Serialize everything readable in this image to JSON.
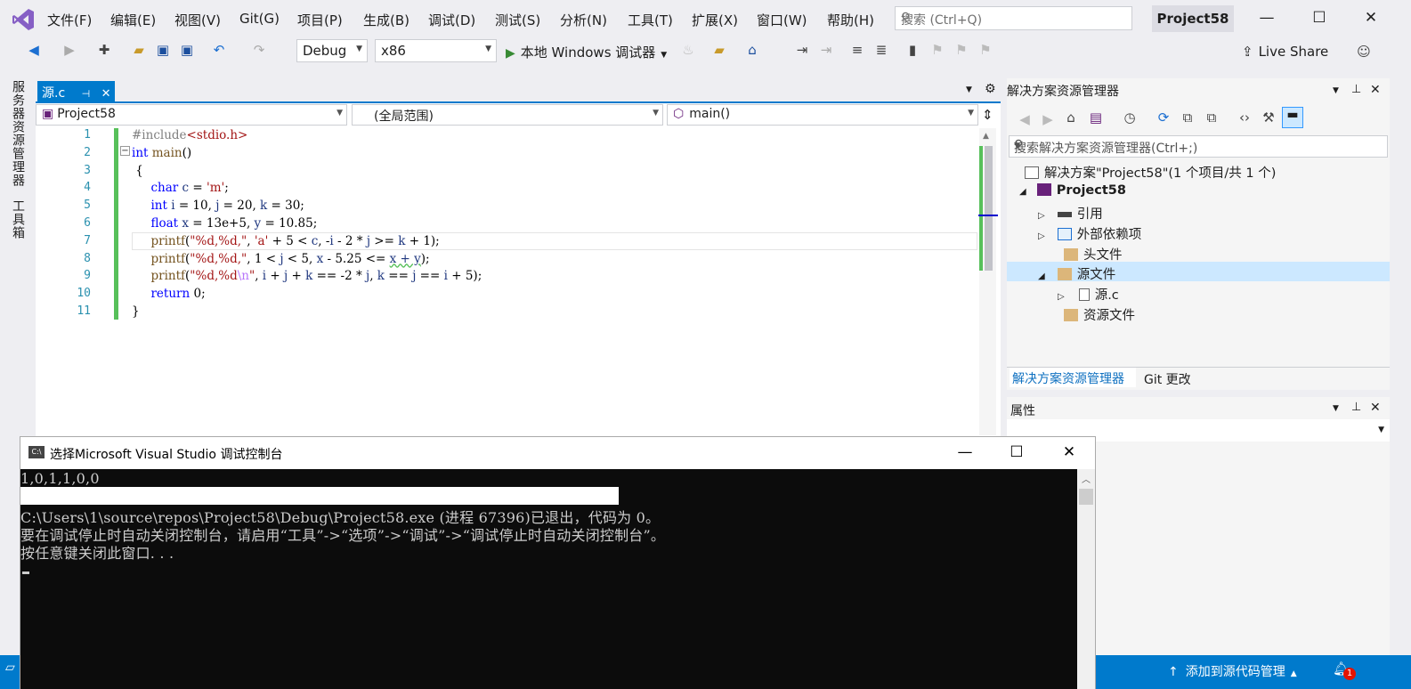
{
  "menu": {
    "items": [
      "文件(F)",
      "编辑(E)",
      "视图(V)",
      "Git(G)",
      "项目(P)",
      "生成(B)",
      "调试(D)",
      "测试(S)",
      "分析(N)",
      "工具(T)",
      "扩展(X)",
      "窗口(W)",
      "帮助(H)"
    ],
    "search_placeholder": "搜索 (Ctrl+Q)",
    "project_name": "Project58"
  },
  "toolbar": {
    "config": "Debug",
    "platform": "x86",
    "run_label": "本地 Windows 调试器",
    "live_share": "Live Share"
  },
  "left_rail": {
    "items": [
      "服务器资源管理器",
      "工具箱"
    ]
  },
  "editor": {
    "tab_name": "源.c",
    "nav_project": "Project58",
    "nav_scope": "(全局范围)",
    "nav_member": "main()",
    "line_numbers": [
      "1",
      "2",
      "3",
      "4",
      "5",
      "6",
      "7",
      "8",
      "9",
      "10",
      "11"
    ]
  },
  "solution_explorer": {
    "title": "解决方案资源管理器",
    "search_placeholder": "搜索解决方案资源管理器(Ctrl+;)",
    "solution": "解决方案\"Project58\"(1 个项目/共 1 个)",
    "project": "Project58",
    "nodes": [
      "引用",
      "外部依赖项",
      "头文件",
      "源文件",
      "源.c",
      "资源文件"
    ],
    "tabs": [
      "解决方案资源管理器",
      "Git 更改"
    ]
  },
  "properties": {
    "title": "属性"
  },
  "status_bar": {
    "source_control": "添加到源代码管理"
  },
  "console": {
    "title": "选择Microsoft Visual Studio 调试控制台",
    "lines": [
      "1,0,1,1,0,0",
      "",
      "C:\\Users\\1\\source\\repos\\Project58\\Debug\\Project58.exe (进程 67396)已退出，代码为 0。",
      "要在调试停止时自动关闭控制台，请启用“工具”->“选项”->“调试”->“调试停止时自动关闭控制台”。",
      "按任意键关闭此窗口. . ."
    ]
  },
  "colors": {
    "accent": "#007acc",
    "change_bar": "#57c05a",
    "console_bg": "#0c0c0c"
  }
}
